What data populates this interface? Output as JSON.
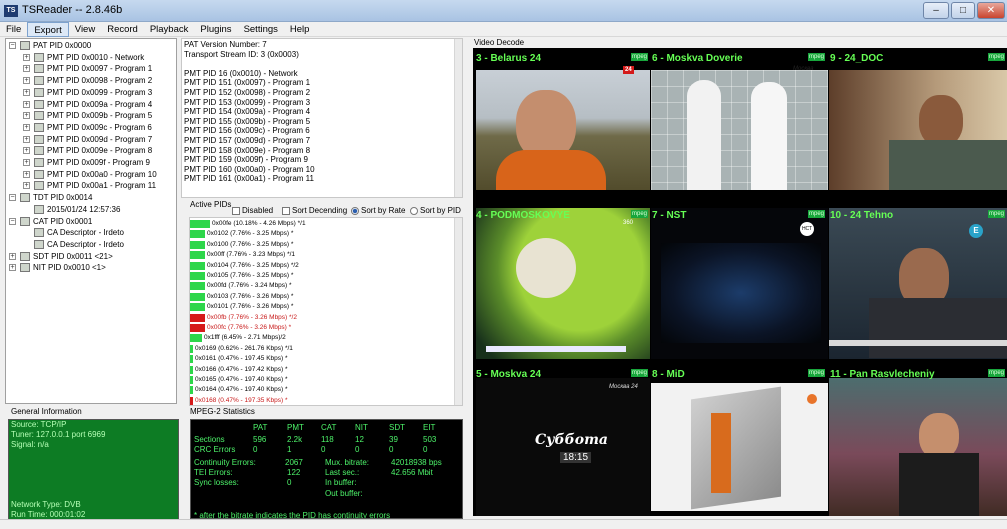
{
  "window": {
    "title": "TSReader -- 2.8.46b",
    "controls": {
      "minimize": "–",
      "maximize": "□",
      "close": "✕"
    }
  },
  "menu": [
    "File",
    "Export",
    "View",
    "Record",
    "Playback",
    "Plugins",
    "Settings",
    "Help"
  ],
  "tree": [
    {
      "label": "PAT PID 0x0000",
      "level": 0,
      "expander": "−"
    },
    {
      "label": "PMT PID 0x0010 - Network",
      "level": 1,
      "expander": "+"
    },
    {
      "label": "PMT PID 0x0097 - Program 1",
      "level": 1,
      "expander": "+"
    },
    {
      "label": "PMT PID 0x0098 - Program 2",
      "level": 1,
      "expander": "+"
    },
    {
      "label": "PMT PID 0x0099 - Program 3",
      "level": 1,
      "expander": "+"
    },
    {
      "label": "PMT PID 0x009a - Program 4",
      "level": 1,
      "expander": "+"
    },
    {
      "label": "PMT PID 0x009b - Program 5",
      "level": 1,
      "expander": "+"
    },
    {
      "label": "PMT PID 0x009c - Program 6",
      "level": 1,
      "expander": "+"
    },
    {
      "label": "PMT PID 0x009d - Program 7",
      "level": 1,
      "expander": "+"
    },
    {
      "label": "PMT PID 0x009e - Program 8",
      "level": 1,
      "expander": "+"
    },
    {
      "label": "PMT PID 0x009f - Program 9",
      "level": 1,
      "expander": "+"
    },
    {
      "label": "PMT PID 0x00a0 - Program 10",
      "level": 1,
      "expander": "+"
    },
    {
      "label": "PMT PID 0x00a1 - Program 11",
      "level": 1,
      "expander": "+"
    },
    {
      "label": "TDT PID 0x0014",
      "level": 0,
      "expander": "−"
    },
    {
      "label": "2015/01/24 12:57:36",
      "level": 1,
      "expander": ""
    },
    {
      "label": "CAT PID 0x0001",
      "level": 0,
      "expander": "−"
    },
    {
      "label": "CA Descriptor - Irdeto",
      "level": 1,
      "expander": ""
    },
    {
      "label": "CA Descriptor - Irdeto",
      "level": 1,
      "expander": ""
    },
    {
      "label": "SDT PID 0x0011 <21>",
      "level": 0,
      "expander": "+"
    },
    {
      "label": "NIT PID 0x0010 <1>",
      "level": 0,
      "expander": "+"
    }
  ],
  "info_lines": [
    "PAT Version Number: 7",
    "Transport Stream ID: 3 (0x0003)",
    "",
    "PMT PID 16 (0x0010) - Network",
    "PMT PID 151 (0x0097) - Program 1",
    "PMT PID 152 (0x0098) - Program 2",
    "PMT PID 153 (0x0099) - Program 3",
    "PMT PID 154 (0x009a) - Program 4",
    "PMT PID 155 (0x009b) - Program 5",
    "PMT PID 156 (0x009c) - Program 6",
    "PMT PID 157 (0x009d) - Program 7",
    "PMT PID 158 (0x009e) - Program 8",
    "PMT PID 159 (0x009f) - Program 9",
    "PMT PID 160 (0x00a0) - Program 10",
    "PMT PID 161 (0x00a1) - Program 11"
  ],
  "active_pids": {
    "title": "Active PIDs",
    "options": {
      "disabled": "Disabled",
      "sort_desc": "Sort Decending",
      "sort_rate": "Sort by Rate",
      "sort_pid": "Sort by PID"
    },
    "selected_sort": "Sort by Rate",
    "rows": [
      {
        "text": "0x00fe (10.18% - 4.26 Mbps) */1",
        "fill": 0.93,
        "color": "#2dd64a"
      },
      {
        "text": "0x0102 (7.76% - 3.25 Mbps) *",
        "fill": 0.71,
        "color": "#2dd64a"
      },
      {
        "text": "0x0100 (7.76% - 3.25 Mbps) *",
        "fill": 0.71,
        "color": "#2dd64a"
      },
      {
        "text": "0x00ff (7.76% - 3.23 Mbps) */1",
        "fill": 0.71,
        "color": "#2dd64a"
      },
      {
        "text": "0x0104 (7.76% - 3.25 Mbps) */2",
        "fill": 0.71,
        "color": "#2dd64a"
      },
      {
        "text": "0x0105 (7.76% - 3.25 Mbps) *",
        "fill": 0.71,
        "color": "#2dd64a"
      },
      {
        "text": "0x00fd (7.76% - 3.24 Mbps) *",
        "fill": 0.71,
        "color": "#2dd64a"
      },
      {
        "text": "0x0103 (7.76% - 3.26 Mbps) *",
        "fill": 0.71,
        "color": "#2dd64a"
      },
      {
        "text": "0x0101 (7.76% - 3.26 Mbps) *",
        "fill": 0.71,
        "color": "#2dd64a"
      },
      {
        "text": "0x00fb (7.76% - 3.26 Mbps) */2",
        "fill": 0.71,
        "color": "#d61a1a",
        "text_color": "#c81818"
      },
      {
        "text": "0x00fc (7.76% - 3.26 Mbps) *",
        "fill": 0.71,
        "color": "#d61a1a",
        "text_color": "#c81818"
      },
      {
        "text": "0x1fff (6.45% - 2.71 Mbps)/2",
        "fill": 0.59,
        "color": "#2dd64a"
      },
      {
        "text": "0x0169 (0.62% - 261.76 Kbps) */1",
        "fill": 0.06,
        "color": "#2dd64a"
      },
      {
        "text": "0x0161 (0.47% - 197.45 Kbps) *",
        "fill": 0.04,
        "color": "#2dd64a"
      },
      {
        "text": "0x0166 (0.47% - 197.42 Kbps) *",
        "fill": 0.04,
        "color": "#2dd64a"
      },
      {
        "text": "0x0165 (0.47% - 197.40 Kbps) *",
        "fill": 0.04,
        "color": "#2dd64a"
      },
      {
        "text": "0x0164 (0.47% - 197.40 Kbps) *",
        "fill": 0.04,
        "color": "#2dd64a"
      },
      {
        "text": "0x0168 (0.47% - 197.35 Kbps) *",
        "fill": 0.04,
        "color": "#d61a1a",
        "text_color": "#c81818"
      }
    ]
  },
  "general_info": {
    "title": "General Information",
    "rows": [
      "Source: TCP/IP",
      "Tuner: 127.0.0.1 port 6969",
      "Signal: n/a",
      "",
      "",
      "",
      "",
      "",
      "Network Type: DVB",
      "Run Time: 000:01:02"
    ]
  },
  "mpeg_stats": {
    "title": "MPEG-2 Statistics",
    "columns": [
      "PAT",
      "PMT",
      "CAT",
      "NIT",
      "SDT",
      "EIT"
    ],
    "sections_label": "Sections",
    "sections": [
      "596",
      "2.2k",
      "118",
      "12",
      "39",
      "503"
    ],
    "crc_label": "CRC Errors",
    "crc": [
      "0",
      "1",
      "0",
      "0",
      "0",
      "0"
    ],
    "continuity_label": "Continuity Errors:",
    "continuity": "2067",
    "tei_label": "TEI Errors:",
    "tei": "122",
    "sync_label": "Sync losses:",
    "sync": "0",
    "mux_label": "Mux. bitrate:",
    "mux": "42018938 bps",
    "last_label": "Last sec.:",
    "last": "42.656 Mbit",
    "inbuf_label": "In buffer:",
    "outbuf_label": "Out buffer:",
    "footnote": "* after the bitrate indicates the PID has continuity errors"
  },
  "video_decode": {
    "title": "Video Decode",
    "tag": "mpeg",
    "cells": [
      "3 - Belarus 24",
      "6 - Moskva Doverie",
      "9 - 24_DOC",
      "4 - PODMOSKOVYE",
      "7 - NST",
      "10 - 24 Tehno",
      "5 - Moskva 24",
      "8 - MiD",
      "11 - Pan Rasvlecheniy"
    ],
    "overlays": {
      "moskva_logo": "Москва",
      "moskva24_logo": "Москва 24",
      "subbota": "Суббота",
      "time": "18:15",
      "belarus_logo": "24",
      "nst_logo": "НСТ",
      "tehno_logo": "E",
      "pod_ch": "360"
    }
  }
}
